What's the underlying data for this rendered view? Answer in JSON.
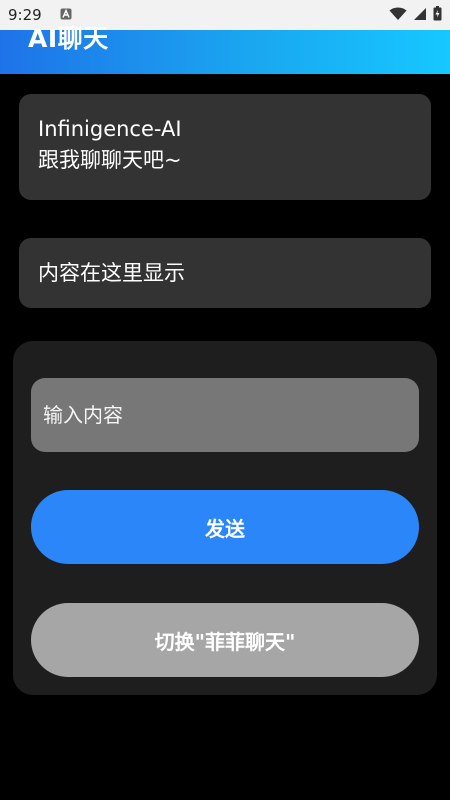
{
  "status_bar": {
    "time": "9:29",
    "icons": [
      "notification-a-icon",
      "wifi-icon",
      "signal-icon",
      "battery-icon"
    ]
  },
  "header": {
    "title": "AI聊天"
  },
  "greeting": {
    "line1": "Infinigence-AI",
    "line2": "跟我聊聊天吧~"
  },
  "response": {
    "text": "内容在这里显示"
  },
  "input": {
    "placeholder": "输入内容",
    "value": ""
  },
  "buttons": {
    "send_label": "发送",
    "switch_label": "切换\"菲菲聊天\""
  },
  "colors": {
    "header_gradient_start": "#1e73e8",
    "header_gradient_end": "#16c8ff",
    "send_button": "#2b87f9",
    "switch_button": "#a6a6a6",
    "card": "#333333",
    "panel": "#1e1e1e",
    "input": "#777777"
  }
}
